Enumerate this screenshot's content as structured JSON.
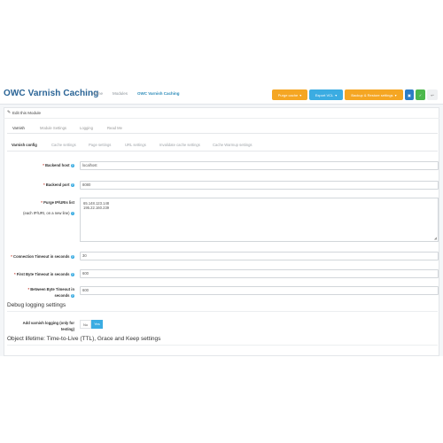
{
  "header": {
    "title": "OWC Varnish Caching",
    "breadcrumbs": [
      "Home",
      "Modules",
      "OWC Varnish Caching"
    ],
    "buttons": {
      "purge_cache": "Purge cache",
      "export_vcl": "Export VCL",
      "backup_restore": "Backup & Restore settings"
    }
  },
  "panel": {
    "heading": "Edit this Module",
    "tabs": [
      "Varnish",
      "Module Settings",
      "Logging",
      "Read Me"
    ],
    "subtabs": [
      "Varnish config",
      "Cache settings",
      "Page settings",
      "URL settings",
      "Invalidate cache settings",
      "Cache Warmup settings"
    ]
  },
  "form": {
    "backend_host": {
      "label": "Backend host",
      "value": "localhost"
    },
    "backend_port": {
      "label": "Backend port",
      "value": "8080"
    },
    "purge_ips": {
      "label": "Purge IP/URIs list",
      "sublabel": "(each IP/URI, on a new line)",
      "lines": [
        "65.148.123.148",
        "195.22.160.239"
      ]
    },
    "connection_timeout": {
      "label": "Connection Timeout in seconds",
      "value": "30"
    },
    "first_byte_timeout": {
      "label": "First Byte Timeout in seconds",
      "value": "600"
    },
    "between_bytes_timeout": {
      "label_line1": "Between Byte Timeout in",
      "label_line2": "seconds",
      "value": "600"
    }
  },
  "debug": {
    "heading": "Debug logging settings",
    "label_line1": "Add varnish logging (only for",
    "label_line2": "testing)",
    "no": "No",
    "yes": "Yes",
    "selected": "Yes"
  },
  "object_lifetime": {
    "heading": "Object lifetime: Time-to-Live (TTL), Grace and Keep settings"
  },
  "colors": {
    "accent": "#3bace2",
    "orange": "#f5a623",
    "green": "#4cb84c",
    "title": "#2a6496"
  },
  "icons": [
    "pencil-icon",
    "question-icon",
    "caret-down-icon",
    "save-icon",
    "check-icon",
    "back-arrow-icon",
    "resize-handle-icon"
  ]
}
